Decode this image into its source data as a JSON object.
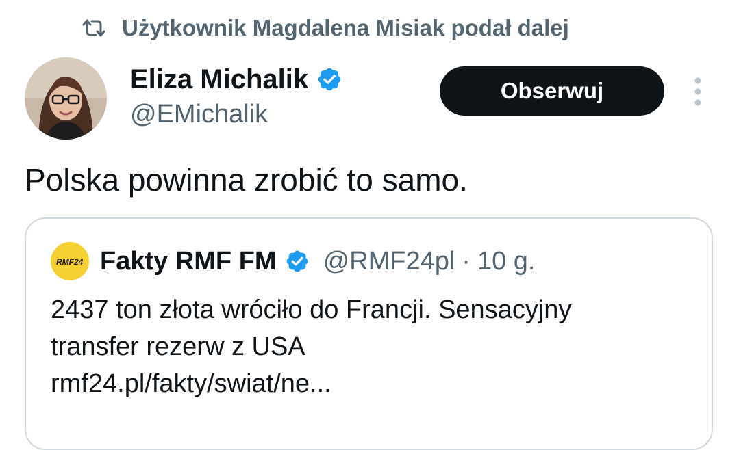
{
  "repost": {
    "icon": "repost-icon",
    "text": "Użytkownik Magdalena Misiak podał dalej"
  },
  "author": {
    "name": "Eliza Michalik",
    "handle": "@EMichalik",
    "verified_icon": "verified-badge-icon",
    "verified_color": "#1d9bf0"
  },
  "follow_button": {
    "label": "Obserwuj"
  },
  "more_menu": {
    "icon": "more-vertical-icon"
  },
  "tweet": {
    "text": "Polska powinna zrobić to samo."
  },
  "quote": {
    "logo_text": "RMF24",
    "logo_color": "#f5d033",
    "name": "Fakty RMF FM",
    "handle": "@RMF24pl",
    "separator": "·",
    "time": "10 g.",
    "lines": [
      "2437 ton złota wróciło do Francji. Sensacyjny",
      "transfer rezerw z USA",
      "rmf24.pl/fakty/swiat/ne..."
    ]
  },
  "colors": {
    "text_primary": "#0f1419",
    "text_secondary": "#536471",
    "border": "#cfd9de",
    "button_bg": "#0f1419",
    "button_text": "#ffffff"
  }
}
